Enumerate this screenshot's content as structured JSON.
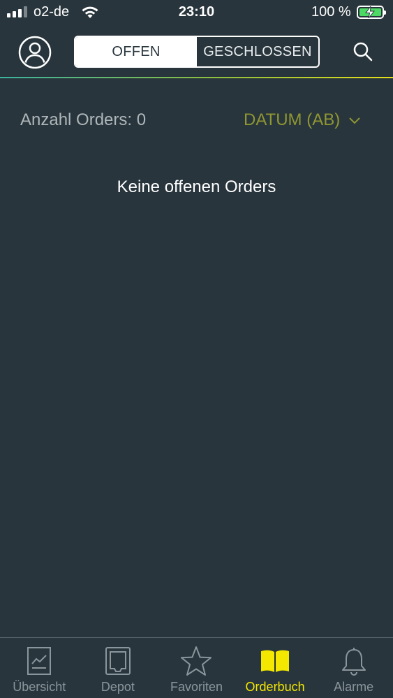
{
  "status_bar": {
    "carrier": "o2-de",
    "time": "23:10",
    "battery": "100 %"
  },
  "header": {
    "tabs": [
      {
        "label": "OFFEN",
        "active": true
      },
      {
        "label": "GESCHLOSSEN",
        "active": false
      }
    ]
  },
  "content": {
    "orders_count": "Anzahl Orders: 0",
    "sort_label": "DATUM (AB)",
    "empty_message": "Keine offenen Orders"
  },
  "tab_bar": {
    "items": [
      {
        "label": "Übersicht",
        "icon": "chart-document-icon",
        "active": false
      },
      {
        "label": "Depot",
        "icon": "wallet-icon",
        "active": false
      },
      {
        "label": "Favoriten",
        "icon": "star-icon",
        "active": false
      },
      {
        "label": "Orderbuch",
        "icon": "open-book-icon",
        "active": true
      },
      {
        "label": "Alarme",
        "icon": "bell-icon",
        "active": false
      }
    ]
  },
  "colors": {
    "background": "#28353c",
    "accent_yellow": "#f4e800",
    "sort_olive": "#8f9632",
    "muted_text": "#aeb6ba"
  }
}
